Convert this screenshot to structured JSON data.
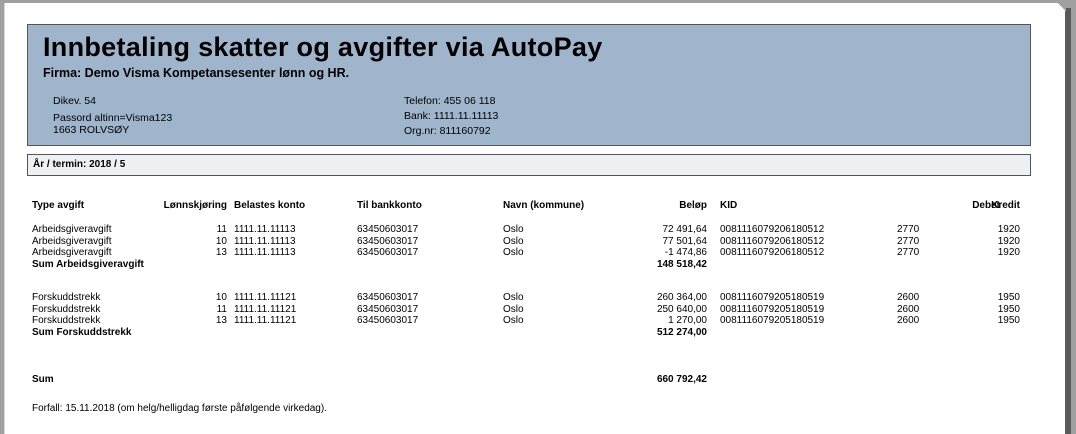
{
  "header": {
    "title": "Innbetaling skatter og avgifter via AutoPay",
    "firma": "Firma: Demo Visma Kompetansesenter lønn og HR.",
    "address": [
      "Dikev. 54",
      "Passord altinn=Visma123",
      "1663 ROLVSØY"
    ],
    "contact": [
      "Telefon: 455 06 118",
      "Bank: 1111.11.11113",
      "Org.nr: 811160792"
    ]
  },
  "termin": "År / termin: 2018 / 5",
  "columns": [
    "Type avgift",
    "Lønnskjøring",
    "Belastes konto",
    "Til bankkonto",
    "Navn (kommune)",
    "Beløp",
    "KID",
    "Debet",
    "Kredit"
  ],
  "groups": [
    {
      "rows": [
        [
          "Arbeidsgiveravgift",
          "11",
          "1111.11.11113",
          "63450603017",
          "Oslo",
          "72 491,64",
          "0081116079206180512",
          "2770",
          "1920"
        ],
        [
          "Arbeidsgiveravgift",
          "10",
          "1111.11.11113",
          "63450603017",
          "Oslo",
          "77 501,64",
          "0081116079206180512",
          "2770",
          "1920"
        ],
        [
          "Arbeidsgiveravgift",
          "13",
          "1111.11.11113",
          "63450603017",
          "Oslo",
          "-1 474,86",
          "0081116079206180512",
          "2770",
          "1920"
        ]
      ],
      "sum_label": "Sum Arbeidsgiveravgift",
      "sum_value": "148 518,42"
    },
    {
      "rows": [
        [
          "Forskuddstrekk",
          "10",
          "1111.11.11121",
          "63450603017",
          "Oslo",
          "260 364,00",
          "0081116079205180519",
          "2600",
          "1950"
        ],
        [
          "Forskuddstrekk",
          "11",
          "1111.11.11121",
          "63450603017",
          "Oslo",
          "250 640,00",
          "0081116079205180519",
          "2600",
          "1950"
        ],
        [
          "Forskuddstrekk",
          "13",
          "1111.11.11121",
          "63450603017",
          "Oslo",
          "1 270,00",
          "0081116079205180519",
          "2600",
          "1950"
        ]
      ],
      "sum_label": "Sum Forskuddstrekk",
      "sum_value": "512 274,00"
    }
  ],
  "total_label": "Sum",
  "total_value": "660 792,42",
  "footer": "Forfall: 15.11.2018 (om helg/helligdag første påfølgende virkedag)."
}
